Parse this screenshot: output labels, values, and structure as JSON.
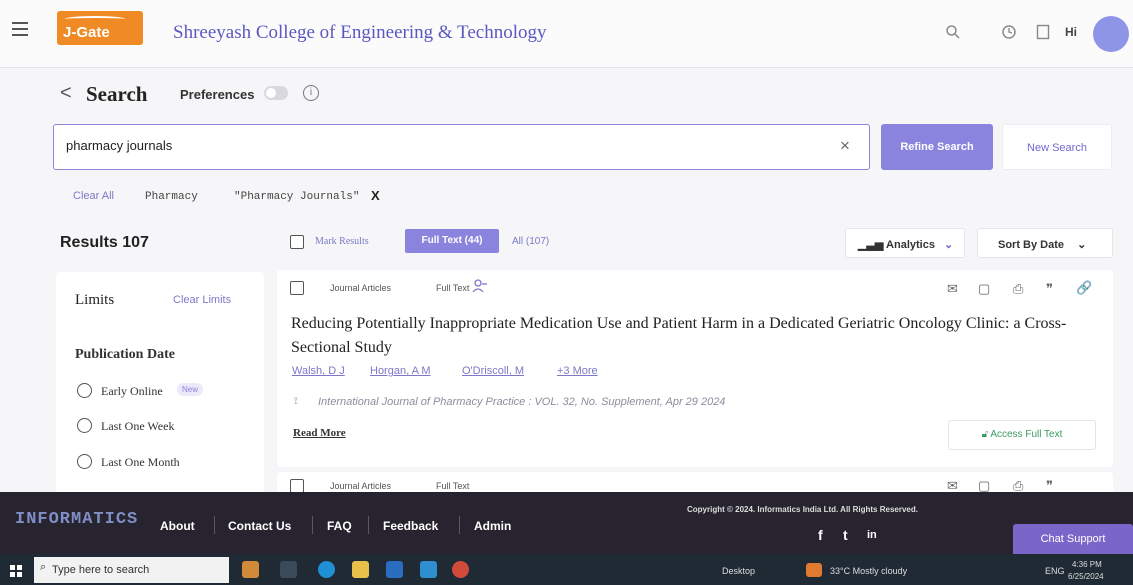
{
  "header": {
    "logo_text": "J-Gate",
    "institution": "Shreeyash College of Engineering & Technology",
    "greeting": "Hi",
    "brand_color": "#f08a24",
    "accent_color": "#8b84de",
    "icons": [
      "search-icon",
      "history-icon",
      "bookmark-icon"
    ]
  },
  "search": {
    "title": "Search",
    "back_glyph": "<",
    "preferences_label": "Preferences",
    "info_glyph": "i",
    "query": "pharmacy journals",
    "clear_glyph": "×",
    "refine_label": "Refine Search",
    "new_search_label": "New Search",
    "clear_all_label": "Clear All",
    "filters": [
      "Pharmacy",
      "\"Pharmacy Journals\""
    ],
    "remove_filter_glyph": "X"
  },
  "results": {
    "count_label": "Results 107",
    "mark_results_label": "Mark Results",
    "tab_fulltext_label": "Full Text (44)",
    "tab_all_label": "All (107)",
    "analytics_label": "Analytics",
    "sort_label": "Sort By Date"
  },
  "limits": {
    "title": "Limits",
    "clear_label": "Clear Limits",
    "section_title": "Publication Date",
    "new_badge": "New",
    "options": [
      "Early Online",
      "Last One Week",
      "Last One Month"
    ]
  },
  "articles": [
    {
      "type_label": "Journal Articles",
      "fulltext_label": "Full Text",
      "title": "Reducing Potentially Inappropriate Medication Use and Patient Harm in a Dedicated Geriatric Oncology Clinic: a Cross-Sectional Study",
      "authors": [
        "Walsh, D J",
        "Horgan, A M",
        "O'Driscoll, M",
        "+3 More"
      ],
      "source": "International Journal of Pharmacy Practice : VOL. 32, No. Supplement, Apr 29 2024",
      "read_more_label": "Read More",
      "access_label": "Access Full Text",
      "action_glyphs": [
        "✉",
        "▢",
        "⎙",
        "❞",
        "🔗"
      ]
    },
    {
      "type_label": "Journal Articles",
      "fulltext_label": "Full Text",
      "action_glyphs": [
        "✉",
        "▢",
        "⎙",
        "❞",
        "🔗"
      ]
    }
  ],
  "footer": {
    "logo_text": "INFORMATICS",
    "links": [
      "About",
      "Contact Us",
      "FAQ",
      "Feedback",
      "Admin"
    ],
    "copyright": "Copyright © 2024. Informatics India Ltd. All Rights Reserved.",
    "social": [
      "f",
      "t",
      "in"
    ],
    "chat_label": "Chat Support"
  },
  "taskbar": {
    "search_placeholder": "Type here to search",
    "desktop_label": "Desktop",
    "weather": "33°C  Mostly cloudy",
    "lang": "ENG",
    "time": "4:36 PM",
    "date": "6/25/2024"
  }
}
